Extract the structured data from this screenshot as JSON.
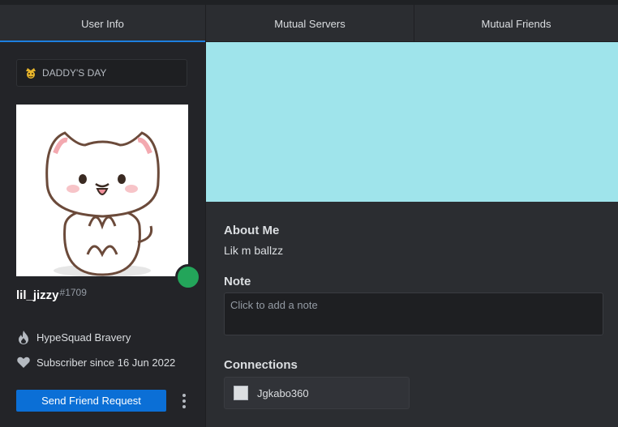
{
  "tabs": [
    {
      "label": "User Info",
      "active": true
    },
    {
      "label": "Mutual Servers",
      "active": false
    },
    {
      "label": "Mutual Friends",
      "active": false
    }
  ],
  "profile": {
    "custom_status": "DADDY'S DAY",
    "status_emoji": "crowned-face-emoji",
    "username": "lil_jizzy",
    "discriminator": "#1709",
    "online_color": "#23a55a",
    "banner_color": "#9fe4eb",
    "badges": [
      {
        "icon": "hypesquad-bravery-icon",
        "label": "HypeSquad Bravery"
      },
      {
        "icon": "heart-icon",
        "label": "Subscriber since 16 Jun 2022"
      }
    ],
    "friend_button": "Send Friend Request"
  },
  "about": {
    "heading": "About Me",
    "text": "Lik m ballzz"
  },
  "note": {
    "heading": "Note",
    "placeholder": "Click to add a note"
  },
  "connections": {
    "heading": "Connections",
    "items": [
      {
        "name": "Jgkabo360"
      }
    ]
  },
  "colors": {
    "accent": "#1d7fe0",
    "button": "#0b6fd6"
  }
}
